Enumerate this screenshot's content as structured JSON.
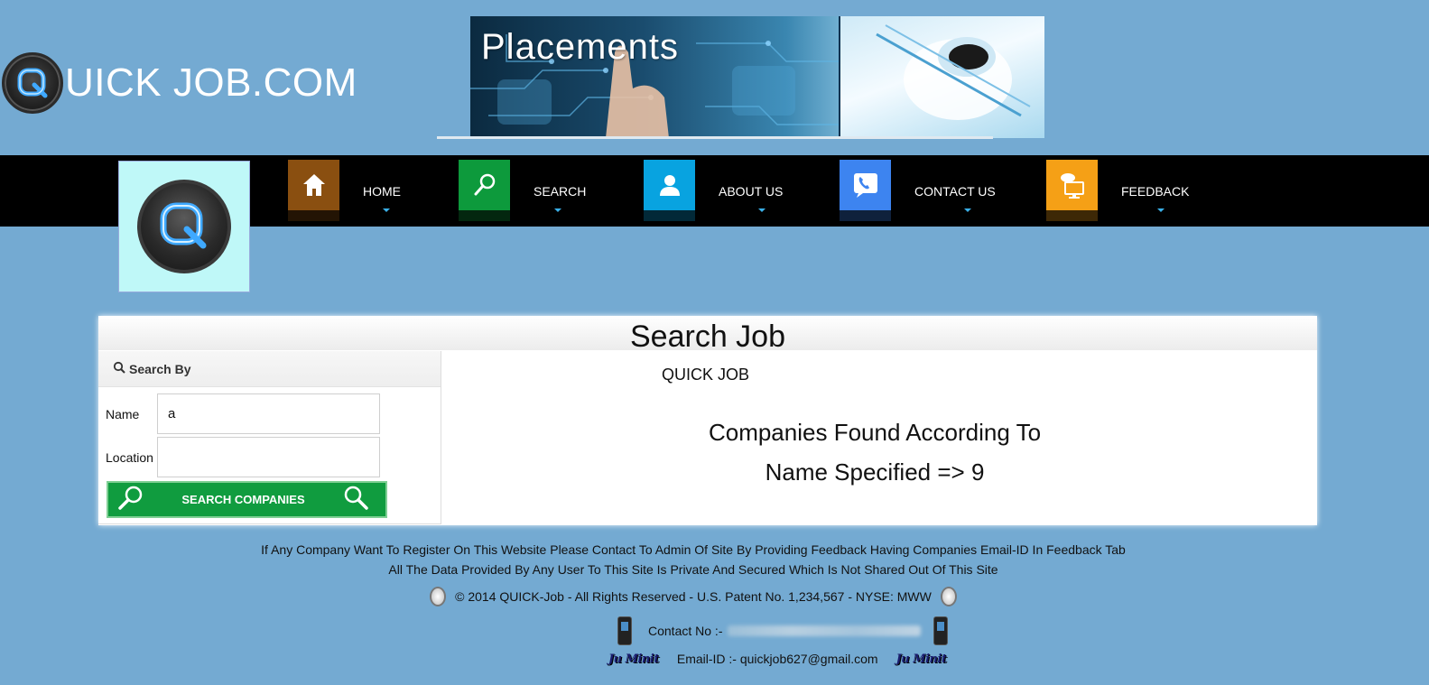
{
  "brand": {
    "title": "UICK JOB.COM"
  },
  "banner": {
    "text": "Placements"
  },
  "nav": {
    "items": [
      {
        "label": "HOME",
        "color": "#8a4f10",
        "icon": "home-icon"
      },
      {
        "label": "SEARCH",
        "color": "#0d9a3c",
        "icon": "search-icon"
      },
      {
        "label": "ABOUT US",
        "color": "#08a3e0",
        "icon": "user-icon"
      },
      {
        "label": "CONTACT US",
        "color": "#3d84f0",
        "icon": "phone-icon"
      },
      {
        "label": "FEEDBACK",
        "color": "#f5a016",
        "icon": "feedback-icon"
      }
    ]
  },
  "panel": {
    "title": "Search Job",
    "subtitle": "QUICK JOB",
    "sidebar_title": "Search By",
    "name_label": "Name",
    "name_value": "a",
    "location_label": "Location",
    "location_value": "",
    "search_button": "SEARCH COMPANIES",
    "result_line1": "Companies Found According To",
    "result_line2": "Name Specified => 9"
  },
  "footer": {
    "line1": "If Any Company Want To Register On This Website Please Contact To Admin Of Site By Providing Feedback Having Companies Email-ID In Feedback Tab",
    "line2": "All The Data Provided By Any User To This Site Is Private And Secured Which Is Not Shared Out Of This Site",
    "copyright": "© 2014 QUICK-Job - All Rights Reserved - U.S. Patent No. 1,234,567 - NYSE: MWW",
    "contact_label": "Contact No :-",
    "email_label": "Email-ID :- quickjob627@gmail.com",
    "signature": "Ju Minit"
  }
}
